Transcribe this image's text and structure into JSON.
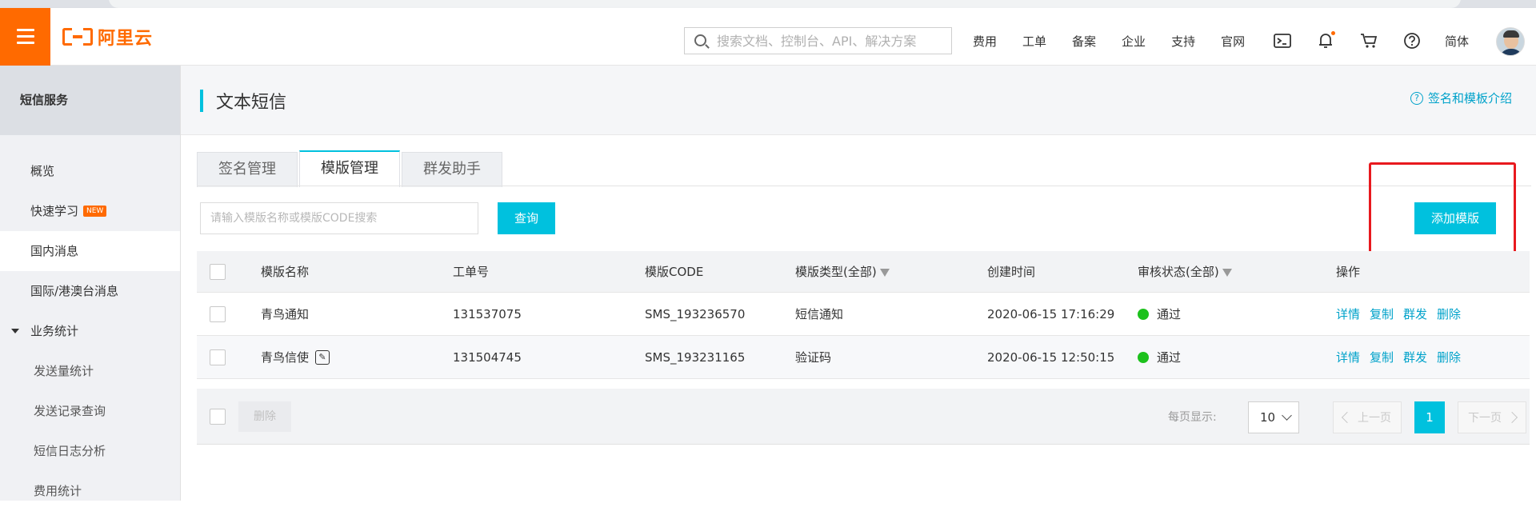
{
  "header": {
    "logo_text": "阿里云",
    "search_placeholder": "搜索文档、控制台、API、解决方案",
    "links": [
      "费用",
      "工单",
      "备案",
      "企业",
      "支持",
      "官网"
    ],
    "lang": "简体",
    "icons": [
      "terminal-icon",
      "bell-icon",
      "cart-icon",
      "help-icon"
    ],
    "accent": "#ff6a00"
  },
  "sidebar": {
    "title": "短信服务",
    "items": [
      {
        "label": "概览"
      },
      {
        "label": "快速学习",
        "badge": "NEW"
      },
      {
        "label": "国内消息"
      },
      {
        "label": "国际/港澳台消息"
      },
      {
        "label": "业务统计"
      },
      {
        "label": "发送量统计"
      },
      {
        "label": "发送记录查询"
      },
      {
        "label": "短信日志分析"
      },
      {
        "label": "费用统计"
      }
    ]
  },
  "main": {
    "title": "文本短信",
    "help_link": "签名和模板介绍",
    "tabs": [
      "签名管理",
      "模版管理",
      "群发助手"
    ],
    "search_placeholder": "请输入模版名称或模版CODE搜索",
    "query_button": "查询",
    "add_button": "添加模版",
    "accent": "#00c1de",
    "table": {
      "columns": [
        "模版名称",
        "工单号",
        "模版CODE",
        "模版类型(全部)",
        "创建时间",
        "审核状态(全部)",
        "操作"
      ],
      "rows": [
        {
          "name": "青鸟通知",
          "ticket": "131537075",
          "code": "SMS_193236570",
          "type": "短信通知",
          "created": "2020-06-15 17:16:29",
          "status": "通过"
        },
        {
          "name": "青鸟信使",
          "ticket": "131504745",
          "code": "SMS_193231165",
          "type": "验证码",
          "created": "2020-06-15 12:50:15",
          "status": "通过"
        }
      ],
      "actions": [
        "详情",
        "复制",
        "群发",
        "删除"
      ]
    },
    "footer": {
      "delete_button": "删除",
      "per_page_label": "每页显示:",
      "per_page_value": "10",
      "prev": "上一页",
      "page": "1",
      "next": "下一页"
    }
  }
}
